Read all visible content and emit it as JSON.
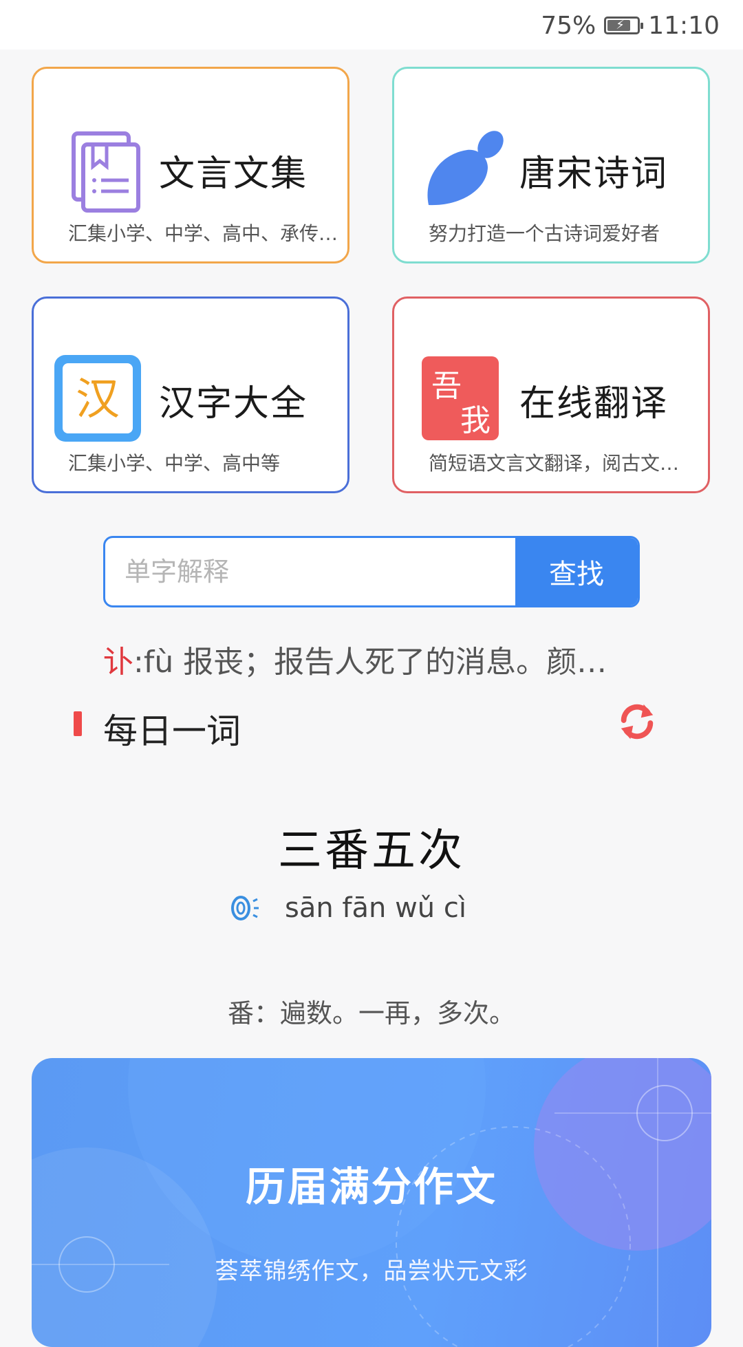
{
  "status_bar": {
    "battery": "75%",
    "time": "11:10"
  },
  "cards": [
    {
      "title": "文言文集",
      "desc": "汇集小学、中学、高中、承传…"
    },
    {
      "title": "唐宋诗词",
      "desc": "努力打造一个古诗词爱好者"
    },
    {
      "title": "汉字大全",
      "desc": "汇集小学、中学、高中等",
      "icon_char": "汉"
    },
    {
      "title": "在线翻译",
      "desc": "简短语文言文翻译，阅古文…",
      "icon_chars": [
        "吾",
        "我"
      ]
    }
  ],
  "search": {
    "placeholder": "单字解释",
    "button": "查找"
  },
  "lookup_result": {
    "char": "讣",
    "text": ":fù 报丧；报告人死了的消息。颜…"
  },
  "daily_word": {
    "section_title": "每日一词",
    "word": "三番五次",
    "pinyin": "sān fān wǔ cì",
    "meaning": "番：遍数。一再，多次。"
  },
  "banner": {
    "title": "历届满分作文",
    "subtitle": "荟萃锦绣作文，品尝状元文彩"
  },
  "colors": {
    "accent": "#3a86f0",
    "card_borders": [
      "#f2a64a",
      "#7fddd0",
      "#4a6fd8",
      "#e06063"
    ],
    "highlight_red": "#e0383e"
  }
}
